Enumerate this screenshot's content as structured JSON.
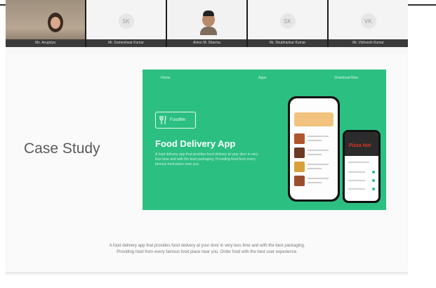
{
  "gallery": {
    "participants": [
      {
        "name": "Ms. Anupriya"
      },
      {
        "name": "Mr. Someshwar Kumar",
        "initials": "SK"
      },
      {
        "name": "Ankur M. Sharma"
      },
      {
        "name": "Mr. Shubhankar Kumar",
        "initials": "SK"
      },
      {
        "name": "Mr. Vishvesh Kumar",
        "initials": "VK"
      }
    ]
  },
  "slide": {
    "heading": "Case Study",
    "banner": {
      "nav": [
        "Home",
        "Apps",
        "Download Now"
      ],
      "logo_text": "FoodMe",
      "app_title": "Food Delivery App",
      "app_description": "A food delivery app that provides food delivery at your door in very less time and with the best packaging. Providing food from every famous food place near you.",
      "second_phone_brand": "Pizza Hut"
    },
    "caption_line1": "A food delivery app that provides food delivery at your door in very less time and with the best packaging.",
    "caption_line2": "Providing food from every famous food place near you. Order food with the best user experience."
  },
  "colors": {
    "banner_green": "#2cbf82",
    "gallery_bg": "#1c1c1c"
  }
}
